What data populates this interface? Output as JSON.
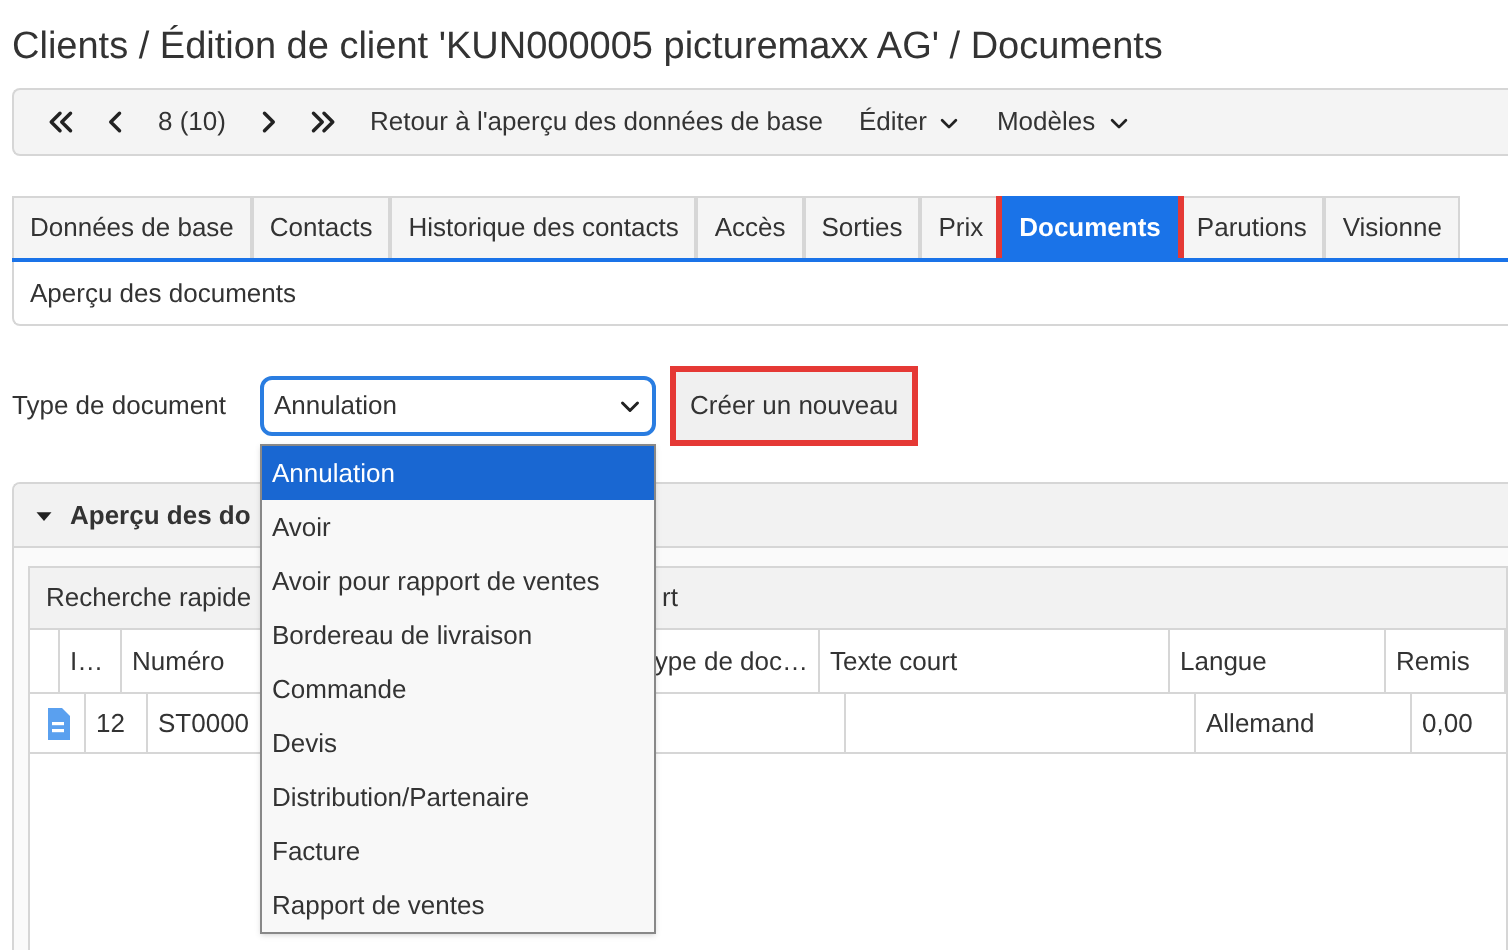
{
  "title": "Clients / Édition de client 'KUN000005 picturemaxx AG' / Documents",
  "toolbar": {
    "pager": "8 (10)",
    "back_link": "Retour à l'aperçu des données de base",
    "menus": [
      "Éditer",
      "Modèles"
    ]
  },
  "tabs": [
    {
      "label": "Données de base",
      "selected": false,
      "highlighted": false
    },
    {
      "label": "Contacts",
      "selected": false,
      "highlighted": false
    },
    {
      "label": "Historique des contacts",
      "selected": false,
      "highlighted": false
    },
    {
      "label": "Accès",
      "selected": false,
      "highlighted": false
    },
    {
      "label": "Sorties",
      "selected": false,
      "highlighted": false
    },
    {
      "label": "Prix",
      "selected": false,
      "highlighted": false
    },
    {
      "label": "Documents",
      "selected": true,
      "highlighted": true
    },
    {
      "label": "Parutions",
      "selected": false,
      "highlighted": false
    },
    {
      "label": "Visionne",
      "selected": false,
      "highlighted": false
    }
  ],
  "subtab": "Aperçu des documents",
  "form": {
    "label": "Type de document",
    "value": "Annulation",
    "expanded": true,
    "options": [
      {
        "label": "Annulation",
        "selected": true
      },
      {
        "label": "Avoir",
        "selected": false
      },
      {
        "label": "Avoir pour rapport de ventes",
        "selected": false
      },
      {
        "label": "Bordereau de livraison",
        "selected": false
      },
      {
        "label": "Commande",
        "selected": false
      },
      {
        "label": "Devis",
        "selected": false
      },
      {
        "label": "Distribution/Partenaire",
        "selected": false
      },
      {
        "label": "Facture",
        "selected": false
      },
      {
        "label": "Rapport de ventes",
        "selected": false
      }
    ]
  },
  "create_button": {
    "label": "Créer un nouveau",
    "highlighted": true
  },
  "panel": {
    "title": "Aperçu des do",
    "expanded": true,
    "quick_search": "Recherche rapide",
    "toolbar_fragment": "rt",
    "columns": [
      "I…",
      "Numéro",
      "ype de doc…",
      "Texte court",
      "Langue",
      "Remis"
    ],
    "rows": [
      {
        "cells": [
          "12",
          "ST0000",
          null,
          null,
          "Allemand",
          "0,00"
        ]
      }
    ]
  }
}
